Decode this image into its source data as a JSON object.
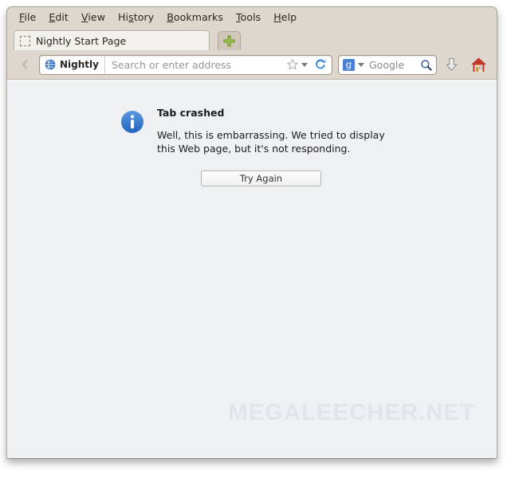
{
  "window": {
    "title": "Nightly Start Page"
  },
  "menubar": {
    "items": [
      {
        "name": "file",
        "pre": "",
        "mnemonic": "F",
        "post": "ile"
      },
      {
        "name": "edit",
        "pre": "",
        "mnemonic": "E",
        "post": "dit"
      },
      {
        "name": "view",
        "pre": "",
        "mnemonic": "V",
        "post": "iew"
      },
      {
        "name": "history",
        "pre": "Hi",
        "mnemonic": "s",
        "post": "tory"
      },
      {
        "name": "bookmarks",
        "pre": "",
        "mnemonic": "B",
        "post": "ookmarks"
      },
      {
        "name": "tools",
        "pre": "",
        "mnemonic": "T",
        "post": "ools"
      },
      {
        "name": "help",
        "pre": "",
        "mnemonic": "H",
        "post": "elp"
      }
    ]
  },
  "tabstrip": {
    "tab_label": "Nightly Start Page",
    "favicon": "blank-favicon-icon",
    "new_tab_icon": "plus-icon"
  },
  "toolbar": {
    "back_icon": "back-arrow-icon",
    "identity_icon": "globe-icon",
    "identity_label": "Nightly",
    "url_placeholder": "Search or enter address",
    "url_value": "",
    "bookmark_icon": "star-icon",
    "bookmark_dropdown_icon": "chevron-down-icon",
    "reload_icon": "reload-icon",
    "search_engine": "Google",
    "search_engine_glyph": "g",
    "search_engine_dropdown_icon": "chevron-down-icon",
    "search_icon": "magnifier-icon",
    "downloads_icon": "download-arrow-icon",
    "home_icon": "home-icon"
  },
  "content": {
    "notification_icon": "info-icon",
    "title": "Tab crashed",
    "body": "Well, this is embarrassing. We tried to display this Web page, but it's not responding.",
    "button_label": "Try Again",
    "watermark": "MEGALEECHER.NET"
  },
  "colors": {
    "chrome": "#ded7cd",
    "content_bg": "#eef0f4",
    "accent_blue": "#2a6cc4",
    "engine_blue": "#4a7fd4",
    "plus_green": "#9ec94a",
    "home_red": "#c0392b",
    "watermark": "#e2e4ea"
  }
}
